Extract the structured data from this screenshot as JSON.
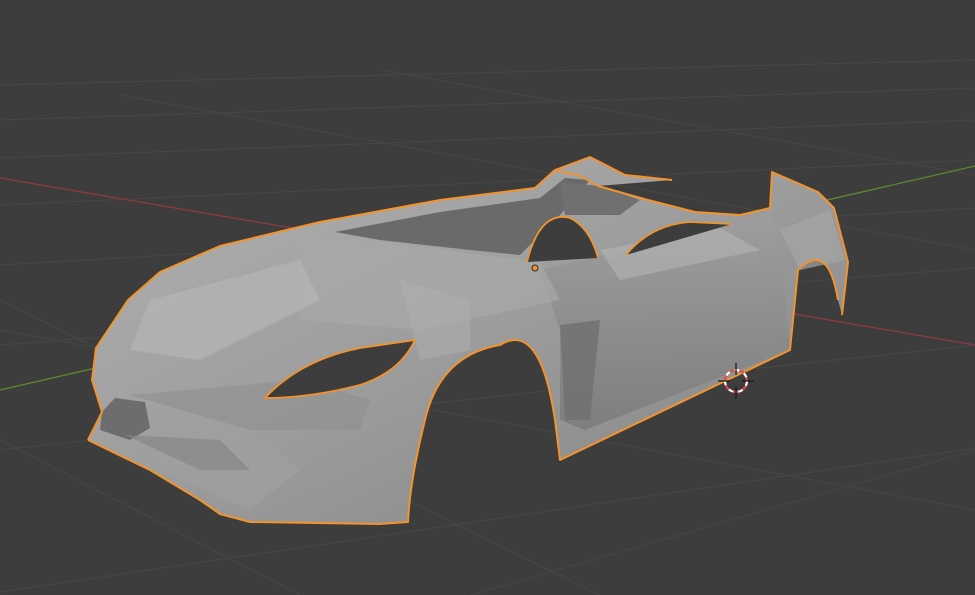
{
  "viewport": {
    "background": "#3d3d3d",
    "grid_color": "#4a4a4a",
    "x_axis_color": "#8f3a43",
    "y_axis_color": "#5b8a2d"
  },
  "selection": {
    "object_outline_color": "#f2932c",
    "origin_color": "#f2932c",
    "is_selected": true
  },
  "object": {
    "kind": "mesh",
    "body_color": "#9a9a9a",
    "shade_dark": "#6e6e6e",
    "shade_light": "#b6b6b6"
  },
  "cursor_3d": {
    "ring_color_a": "#e34a4a",
    "ring_color_b": "#ffffff",
    "crosshair_color": "#1a1a1a"
  }
}
